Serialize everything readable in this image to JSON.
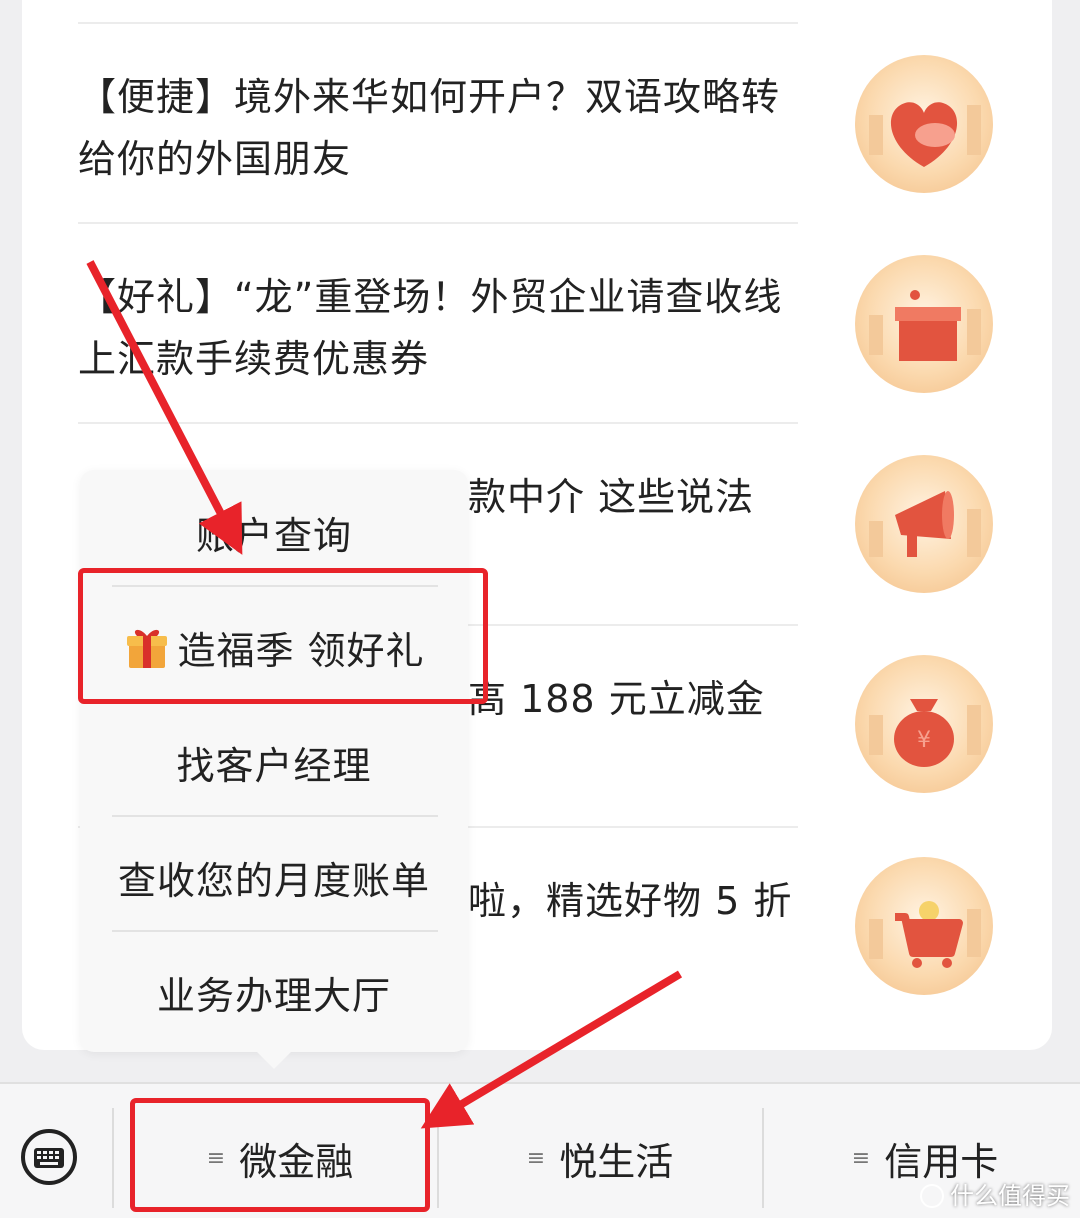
{
  "articles": [
    {
      "title": "【便捷】境外来华如何开户？双语攻略转给你的外国朋友",
      "icon": "heart-icon"
    },
    {
      "title": "【好礼】“龙”重登场！外贸企业请查收线上汇款手续费优惠券",
      "icon": "gift-box-icon"
    },
    {
      "title": "款中介 这些说法",
      "icon": "megaphone-icon"
    },
    {
      "title": "高 188 元立减金",
      "icon": "money-bag-icon"
    },
    {
      "title": "啦，精选好物 5 折",
      "icon": "shopping-cart-icon"
    }
  ],
  "popup_menu": {
    "items": [
      {
        "label": "账户查询"
      },
      {
        "label": "造福季 领好礼",
        "icon": "gift-icon"
      },
      {
        "label": "找客户经理"
      },
      {
        "label": "查收您的月度账单"
      },
      {
        "label": "业务办理大厅"
      }
    ]
  },
  "bottom_tabs": [
    {
      "label": "微金融"
    },
    {
      "label": "悦生活"
    },
    {
      "label": "信用卡"
    }
  ],
  "hamburger_glyph": "≡",
  "keyboard_icon": "keyboard-icon",
  "watermark": "什么值得买",
  "colors": {
    "highlight": "#e8232a",
    "thumb_orange": "#f2bd85",
    "icon_red": "#e2543f"
  }
}
